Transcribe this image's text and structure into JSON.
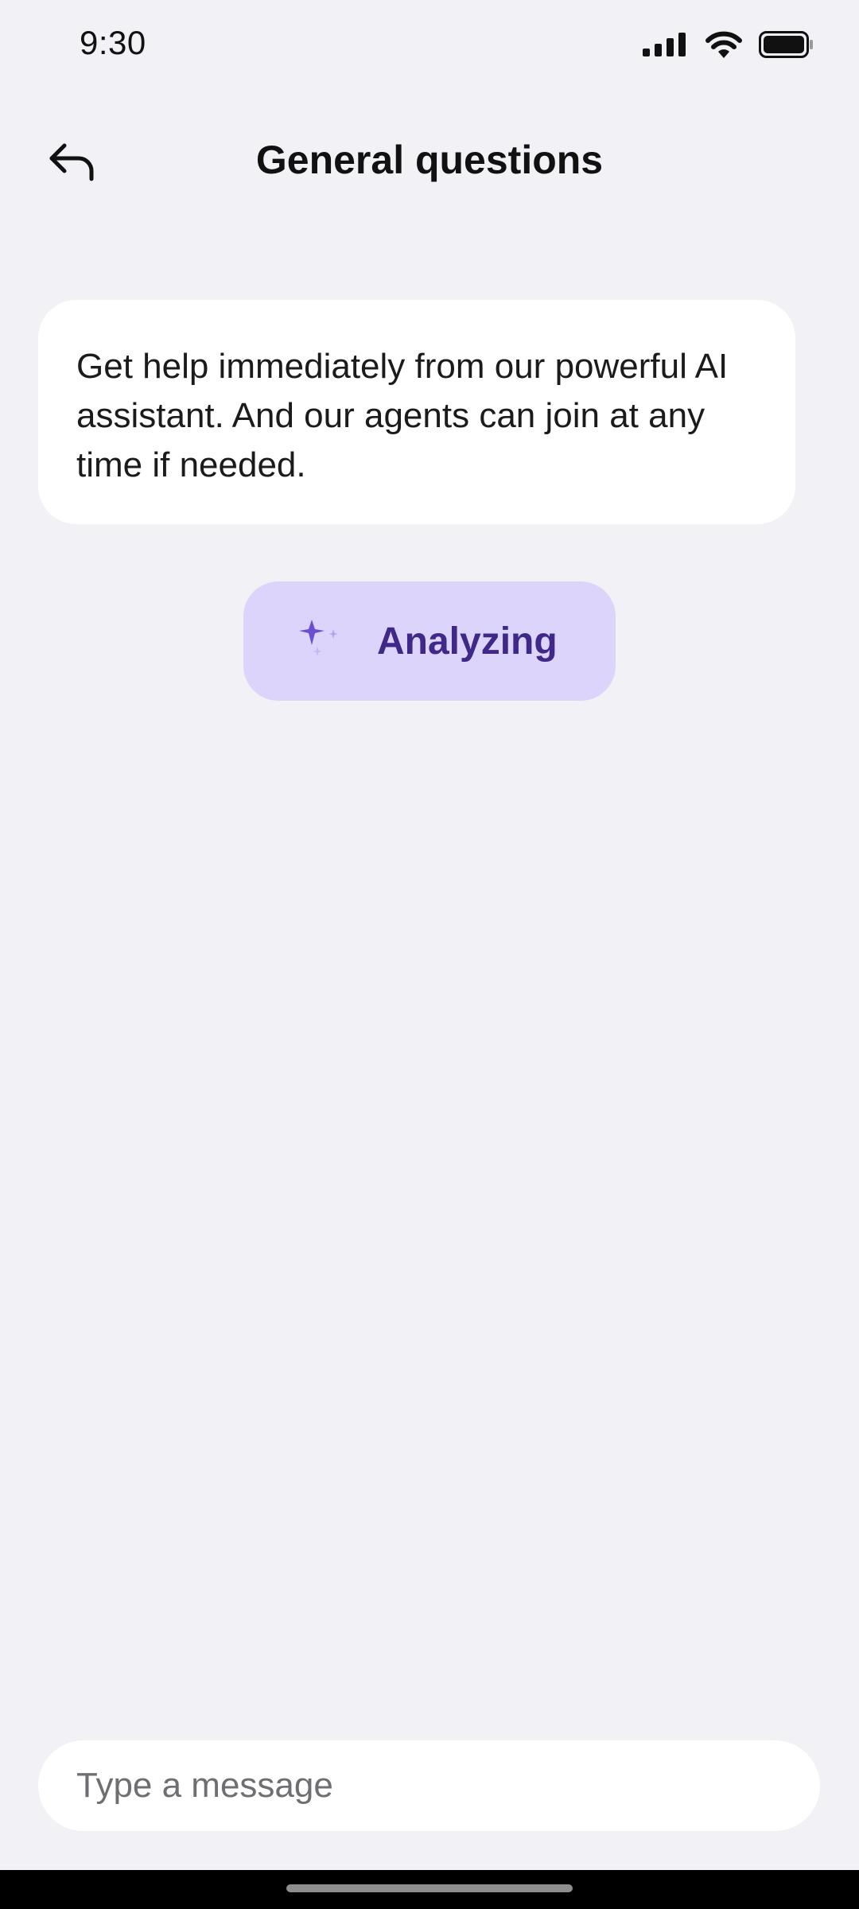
{
  "status_bar": {
    "time": "9:30",
    "icons": [
      "signal-icon",
      "wifi-icon",
      "battery-icon"
    ]
  },
  "header": {
    "back_icon": "back-arrow-icon",
    "title": "General questions"
  },
  "chat": {
    "intro_message": "Get help immediately from our powerful AI assistant. And our agents can join at any time if needed.",
    "analyzing": {
      "icon": "sparkle-icon",
      "label": "Analyzing"
    }
  },
  "composer": {
    "value": "",
    "placeholder": "Type a message"
  },
  "colors": {
    "background": "#f2f1f6",
    "bubble": "#ffffff",
    "chip_background": "#dcd4fb",
    "chip_text": "#3f2888",
    "sparkle": "#6a4fd0"
  }
}
